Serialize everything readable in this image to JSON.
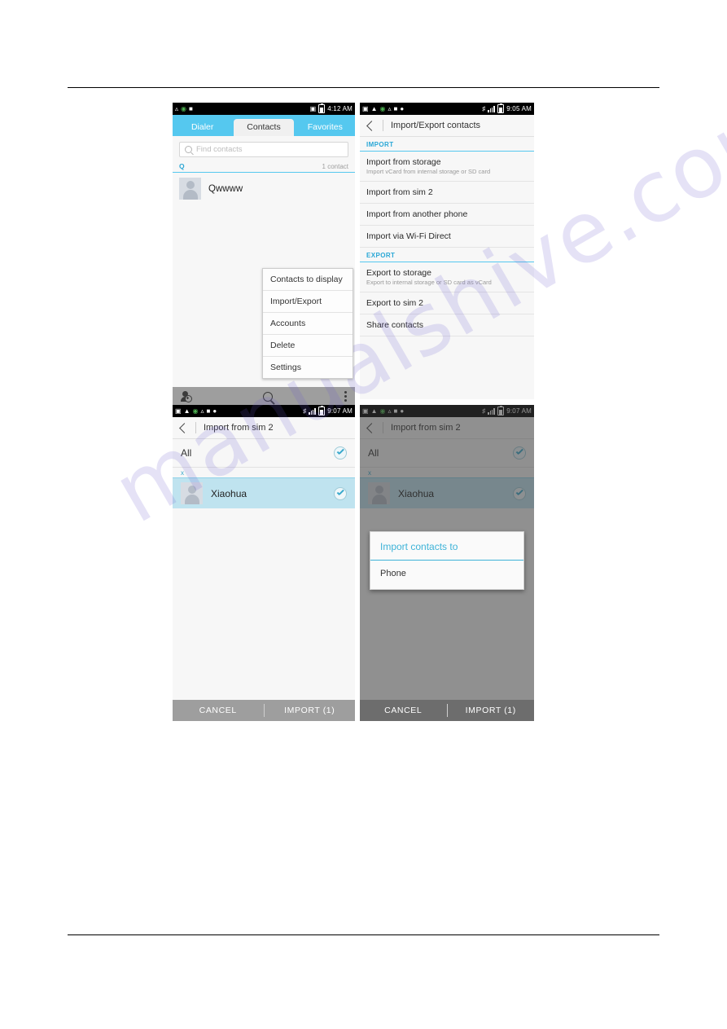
{
  "watermark": {
    "text": "manualshive.com"
  },
  "screen1": {
    "name": "contacts-list",
    "statusbar": {
      "time": "4:12 AM",
      "icons": [
        "usb-icon",
        "browser-icon",
        "android-icon",
        "sync-icon",
        "battery-icon"
      ]
    },
    "tabs": [
      {
        "label": "Dialer",
        "active": false
      },
      {
        "label": "Contacts",
        "active": true
      },
      {
        "label": "Favorites",
        "active": false
      }
    ],
    "search": {
      "placeholder": "Find contacts",
      "value": ""
    },
    "section": {
      "letter": "Q",
      "count": "1 contact"
    },
    "contacts": [
      {
        "name": "Qwwww"
      }
    ],
    "menu": {
      "items": [
        {
          "label": "Contacts to display"
        },
        {
          "label": "Import/Export"
        },
        {
          "label": "Accounts"
        },
        {
          "label": "Delete"
        },
        {
          "label": "Settings"
        }
      ]
    },
    "bottombar": {
      "icons": [
        "add-contact-icon",
        "search-icon",
        "overflow-menu-icon"
      ]
    }
  },
  "screen2": {
    "name": "import-export-contacts",
    "statusbar": {
      "time": "9:05 AM"
    },
    "title": "Import/Export contacts",
    "groups": [
      {
        "label": "IMPORT",
        "items": [
          {
            "title": "Import from storage",
            "subtitle": "Import vCard from internal storage or SD card"
          },
          {
            "title": "Import from sim 2",
            "subtitle": ""
          },
          {
            "title": "Import from another phone",
            "subtitle": ""
          },
          {
            "title": "Import via Wi-Fi Direct",
            "subtitle": ""
          }
        ]
      },
      {
        "label": "EXPORT",
        "items": [
          {
            "title": "Export to storage",
            "subtitle": "Export to internal storage or SD card as vCard"
          },
          {
            "title": "Export to sim 2",
            "subtitle": ""
          },
          {
            "title": "Share contacts",
            "subtitle": ""
          }
        ]
      }
    ]
  },
  "screen3": {
    "name": "import-from-sim-selection",
    "statusbar": {
      "time": "9:07 AM"
    },
    "title": "Import from sim 2",
    "all_row": {
      "label": "All",
      "checked": true
    },
    "section_letter": "x",
    "contacts": [
      {
        "name": "Xiaohua",
        "checked": true,
        "selected": true
      }
    ],
    "footer": {
      "cancel": "CANCEL",
      "import": "IMPORT  (1)"
    }
  },
  "screen4": {
    "name": "import-contacts-to-dialog",
    "statusbar": {
      "time": "9:07 AM"
    },
    "title": "Import from sim 2",
    "all_row": {
      "label": "All",
      "checked": true
    },
    "section_letter": "x",
    "contacts": [
      {
        "name": "Xiaohua",
        "checked": true,
        "selected": true
      }
    ],
    "dialog": {
      "title": "Import contacts to",
      "options": [
        {
          "label": "Phone"
        }
      ]
    },
    "footer": {
      "cancel": "CANCEL",
      "import": "IMPORT  (1)"
    }
  },
  "colors": {
    "accent_blue": "#55c8ef",
    "teal_text": "#29a7d6",
    "tabbar": "#55c8ef",
    "bottom_gray": "#9e9e9e",
    "row_selected": "#bfe3ef"
  }
}
